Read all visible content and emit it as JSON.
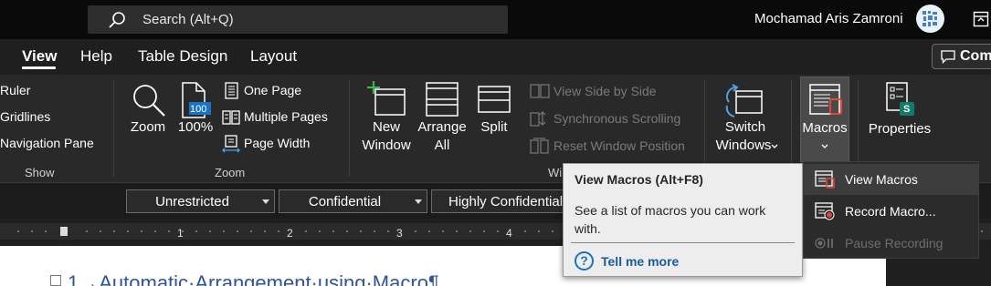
{
  "titlebar": {
    "search_placeholder": "Search (Alt+Q)",
    "user_name": "Mochamad Aris Zamroni"
  },
  "tabs": [
    {
      "label": "View",
      "active": true
    },
    {
      "label": "Help"
    },
    {
      "label": "Table Design"
    },
    {
      "label": "Layout"
    }
  ],
  "comments_button": "Com",
  "ribbon": {
    "show": {
      "label": "Show",
      "items": [
        "Ruler",
        "Gridlines",
        "Navigation Pane"
      ]
    },
    "zoom": {
      "label": "Zoom",
      "zoom_button": "Zoom",
      "hundred_button": "100%",
      "hundred_icon_text": "100",
      "one_page": "One Page",
      "multiple_pages": "Multiple Pages",
      "page_width": "Page Width"
    },
    "window": {
      "label": "Wi",
      "new_window": [
        "New",
        "Window"
      ],
      "arrange_all": [
        "Arrange",
        "All"
      ],
      "split": "Split",
      "view_side_by_side": "View Side by Side",
      "synchronous_scrolling": "Synchronous Scrolling",
      "reset_window_position": "Reset Window Position",
      "switch_windows": [
        "Switch",
        "Windows"
      ]
    },
    "macros": {
      "label": "Macros"
    },
    "sharepoint": {
      "properties": "Properties",
      "icon_letter": "S"
    }
  },
  "sensitivity": [
    "Unrestricted",
    "Confidential",
    "Highly Confidential"
  ],
  "ruler": {
    "numbers": [
      "1",
      "2",
      "3",
      "4"
    ]
  },
  "document": {
    "heading": "1→Automatic·Arrangement·using·Macro¶"
  },
  "tooltip": {
    "title": "View Macros (Alt+F8)",
    "description": "See a list of macros you can work with.",
    "tell_me_more": "Tell me more"
  },
  "macros_menu": [
    {
      "label": "View Macros",
      "icon": "view-macros-icon"
    },
    {
      "label": "Record Macro...",
      "icon": "record-macro-icon"
    },
    {
      "label": "Pause Recording",
      "icon": "pause-recording-icon",
      "disabled": true
    }
  ],
  "colors": {
    "accent_blue": "#1a73c2",
    "sharepoint_teal": "#0f7b6c",
    "record_red": "#e0483c"
  }
}
